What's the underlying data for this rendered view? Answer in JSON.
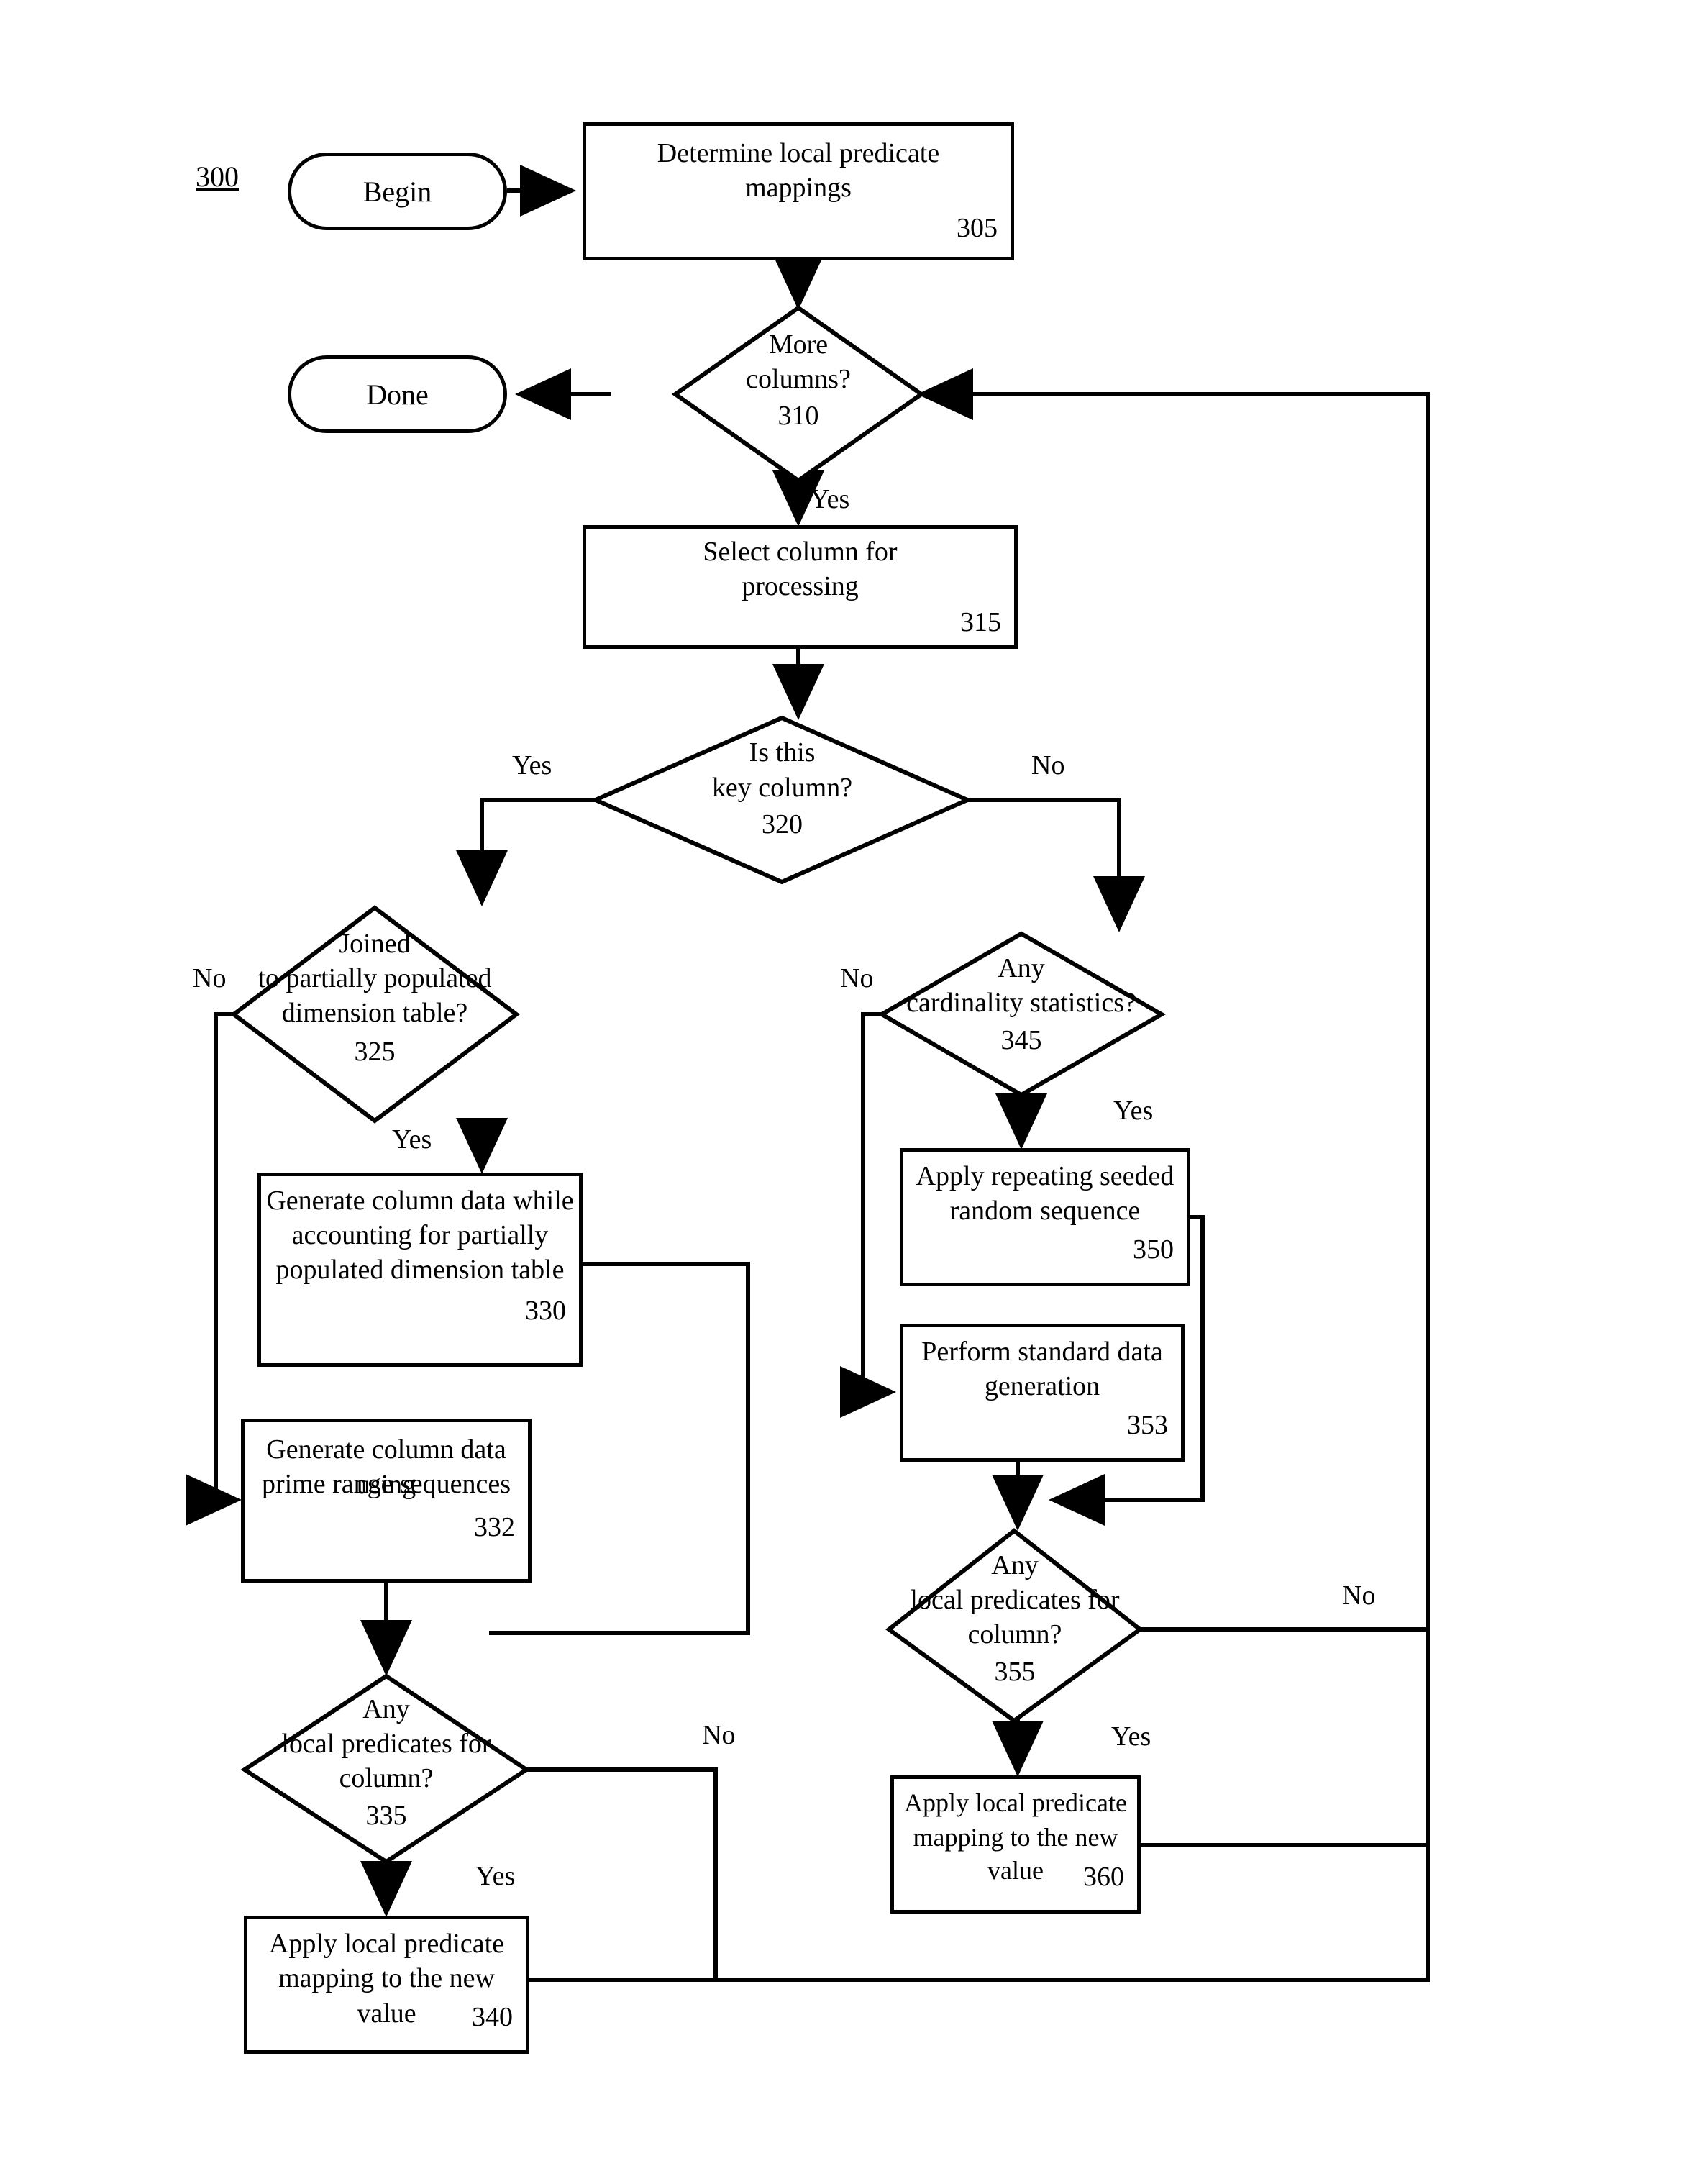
{
  "figure": {
    "number": "300"
  },
  "nodes": {
    "begin": {
      "label": "Begin",
      "shape": "terminator"
    },
    "done": {
      "label": "Done",
      "shape": "terminator"
    },
    "n305": {
      "line1": "Determine local predicate",
      "line2": "mappings",
      "ref": "305",
      "shape": "process"
    },
    "n310": {
      "line1": "More",
      "line2": "columns?",
      "ref": "310",
      "shape": "decision"
    },
    "n315": {
      "line1": "Select column for",
      "line2": "processing",
      "ref": "315",
      "shape": "process"
    },
    "n320": {
      "line1": "Is this",
      "line2": "key column?",
      "ref": "320",
      "shape": "decision"
    },
    "n325": {
      "line1": "Joined",
      "line2": "to partially populated",
      "line3": "dimension table?",
      "ref": "325",
      "shape": "decision"
    },
    "n330": {
      "line1": "Generate column data while",
      "line2": "accounting for partially",
      "line3": "populated dimension table",
      "ref": "330",
      "shape": "process"
    },
    "n332": {
      "line1": "Generate column data using",
      "line2": "prime range sequences",
      "ref": "332",
      "shape": "process"
    },
    "n335": {
      "line1": "Any",
      "line2": "local predicates for",
      "line3": "column?",
      "ref": "335",
      "shape": "decision"
    },
    "n340": {
      "line1": "Apply local predicate",
      "line2": "mapping to the new value",
      "ref": "340",
      "shape": "process"
    },
    "n345": {
      "line1": "Any",
      "line2": "cardinality statistics?",
      "ref": "345",
      "shape": "decision"
    },
    "n350": {
      "line1": "Apply repeating seeded",
      "line2": "random sequence",
      "ref": "350",
      "shape": "process"
    },
    "n353": {
      "line1": "Perform standard data",
      "line2": "generation",
      "ref": "353",
      "shape": "process"
    },
    "n355": {
      "line1": "Any",
      "line2": "local predicates for",
      "line3": "column?",
      "ref": "355",
      "shape": "decision"
    },
    "n360": {
      "line1": "Apply local predicate",
      "line2": "mapping to the new value",
      "ref": "360",
      "shape": "process"
    }
  },
  "edge_labels": {
    "e310_yes": "Yes",
    "e320_yes": "Yes",
    "e320_no": "No",
    "e325_no": "No",
    "e325_yes": "Yes",
    "e335_no": "No",
    "e335_yes": "Yes",
    "e345_no": "No",
    "e345_yes": "Yes",
    "e355_no": "No",
    "e355_yes": "Yes"
  },
  "style": {
    "stroke": "#000000",
    "fill": "#ffffff"
  }
}
